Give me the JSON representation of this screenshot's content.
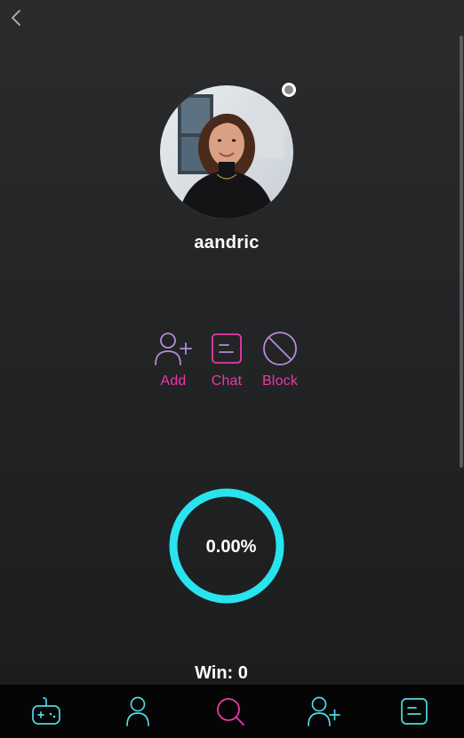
{
  "profile": {
    "username": "aandric",
    "status": "offline"
  },
  "actions": {
    "add_label": "Add",
    "chat_label": "Chat",
    "block_label": "Block"
  },
  "stats": {
    "win_ratio": 0.0,
    "win_ratio_text": "0.00%",
    "win_text": "Win: 0"
  },
  "colors": {
    "accent_pink": "#e93aa8",
    "icon_purple": "#b58ad8",
    "ring_cyan": "#29e4ef",
    "nav_cyan": "#4fd8e6",
    "nav_active": "#e93aa8",
    "background": "#232425"
  },
  "navbar": {
    "items": [
      {
        "icon": "gamepad-icon",
        "active": false
      },
      {
        "icon": "user-icon",
        "active": false
      },
      {
        "icon": "search-icon",
        "active": true
      },
      {
        "icon": "add-user-icon",
        "active": false
      },
      {
        "icon": "chat-icon",
        "active": false
      }
    ]
  }
}
